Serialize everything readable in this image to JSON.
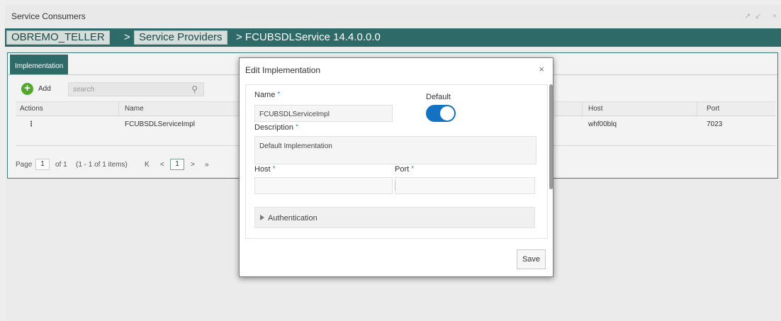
{
  "window": {
    "title": "Service Consumers",
    "controls": "↗↙ ×"
  },
  "breadcrumb": {
    "root": "OBREMO_TELLER",
    "sep1": ">",
    "providers": "Service Providers",
    "current": "> FCUBSDLService 14.4.0.0.0"
  },
  "tabs": [
    {
      "label": "Implementation"
    }
  ],
  "toolbar": {
    "add_label": "Add",
    "search_placeholder": "search"
  },
  "table": {
    "headers": [
      "Actions",
      "Name",
      "Host",
      "Port"
    ],
    "rows": [
      {
        "action": "⋮",
        "name": "FCUBSDLServiceImpl",
        "host": "whf00blq",
        "port": "7023"
      }
    ]
  },
  "pager": {
    "page_label": "Page",
    "page": "1",
    "of": "of 1",
    "items": "(1 - 1 of 1 items)",
    "first": "K",
    "prev": "<",
    "current": "1",
    "next": ">",
    "last": "»"
  },
  "modal": {
    "title": "Edit Implementation",
    "close": "×",
    "name_label": "Name",
    "name_value": "FCUBSDLServiceImpl",
    "default_label": "Default",
    "default_on": true,
    "description_label": "Description",
    "description_value": "Default Implementation",
    "host_label": "Host",
    "host_value": "",
    "port_label": "Port",
    "port_value": "",
    "required_mark": "*",
    "authentication_label": "Authentication",
    "save_label": "Save"
  },
  "colors": {
    "accent": "#2e6b68",
    "toggle": "#1372c4",
    "add": "#54a82e",
    "required": "#3a8bb3"
  }
}
